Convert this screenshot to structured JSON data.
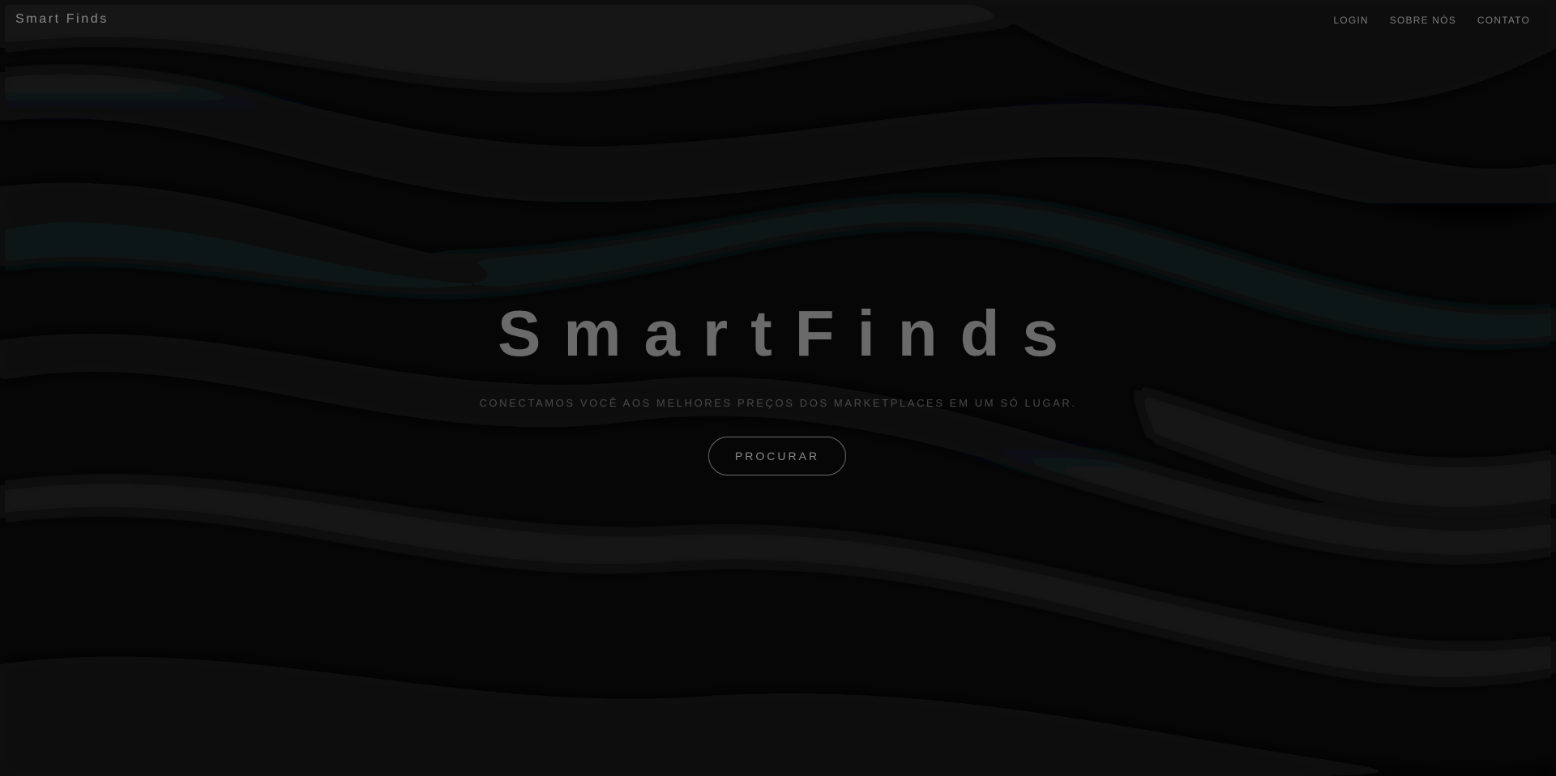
{
  "header": {
    "logo": "Smart Finds",
    "nav": [
      {
        "label": "LOGIN"
      },
      {
        "label": "SOBRE NÓS"
      },
      {
        "label": "CONTATO"
      }
    ]
  },
  "hero": {
    "title": "SmartFinds",
    "subtitle": "CONECTAMOS VOCÊ AOS MELHORES PREÇOS DOS MARKETPLACES EM UM SÓ LUGAR.",
    "button_label": "PROCURAR"
  },
  "colors": {
    "background": "#060606",
    "title": "#6a6a6a",
    "subtitle": "#4a4a4a",
    "nav_text": "#7c7c7c",
    "button_border": "#6a6a6a"
  }
}
